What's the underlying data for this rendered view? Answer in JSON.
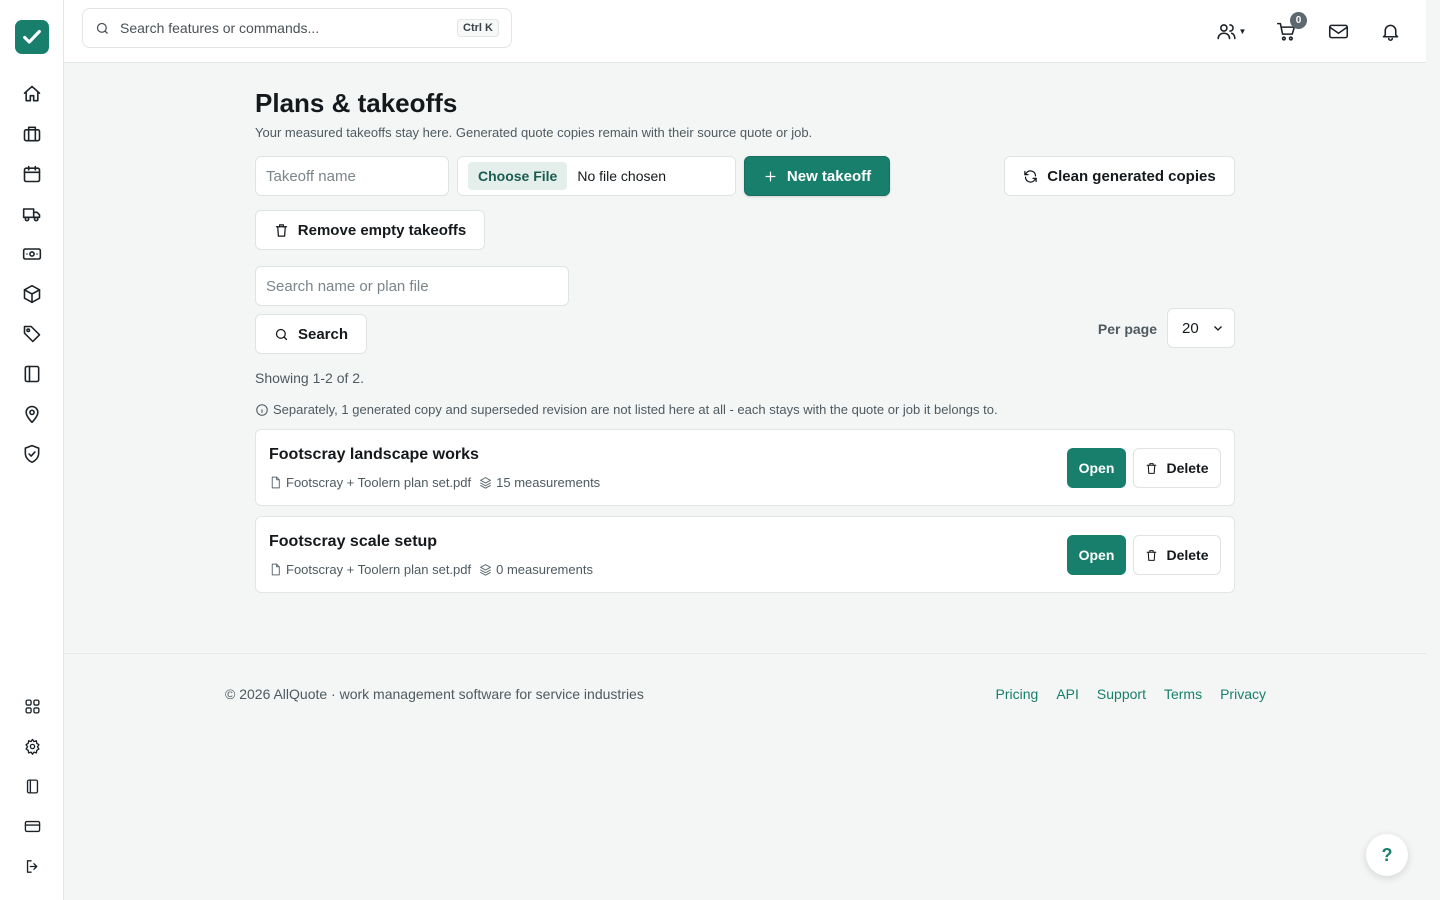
{
  "app": {
    "accent_color": "#177f6c",
    "logo_icon": "check-icon"
  },
  "sidebar": {
    "items": [
      {
        "name": "home-icon"
      },
      {
        "name": "briefcase-icon"
      },
      {
        "name": "calendar-icon"
      },
      {
        "name": "truck-icon"
      },
      {
        "name": "cash-icon"
      },
      {
        "name": "box-icon"
      },
      {
        "name": "tag-icon"
      },
      {
        "name": "book-icon"
      },
      {
        "name": "map-pin-icon"
      },
      {
        "name": "shield-check-icon"
      }
    ],
    "bottom_items": [
      {
        "name": "apps-grid-icon"
      },
      {
        "name": "settings-gear-icon"
      },
      {
        "name": "panel-icon"
      },
      {
        "name": "credit-card-icon"
      },
      {
        "name": "logout-icon"
      }
    ]
  },
  "topbar": {
    "search_placeholder": "Search features or commands...",
    "shortcut": "Ctrl K",
    "cart_count": "0"
  },
  "page": {
    "title": "Plans & takeoffs",
    "subtitle": "Your measured takeoffs stay here. Generated quote copies remain with their source quote or job."
  },
  "create": {
    "name_placeholder": "Takeoff name",
    "choose_file_label": "Choose File",
    "file_status": "No file chosen",
    "new_button": "New takeoff",
    "clean_button": "Clean generated copies",
    "remove_button": "Remove empty takeoffs"
  },
  "filter": {
    "search_placeholder": "Search name or plan file",
    "search_button": "Search",
    "per_page_label": "Per page",
    "per_page_value": "20"
  },
  "results": {
    "showing": "Showing 1-2 of 2.",
    "notice": "Separately, 1 generated copy and superseded revision are not listed here at all - each stays with the quote or job it belongs to."
  },
  "takeoffs": [
    {
      "title": "Footscray landscape works",
      "file": "Footscray + Toolern plan set.pdf",
      "measurements": "15 measurements",
      "open_label": "Open",
      "delete_label": "Delete"
    },
    {
      "title": "Footscray scale setup",
      "file": "Footscray + Toolern plan set.pdf",
      "measurements": "0 measurements",
      "open_label": "Open",
      "delete_label": "Delete"
    }
  ],
  "footer": {
    "copyright": "© 2026 AllQuote · work management software for service industries",
    "links": [
      "Pricing",
      "API",
      "Support",
      "Terms",
      "Privacy"
    ]
  },
  "help": {
    "label": "?"
  }
}
